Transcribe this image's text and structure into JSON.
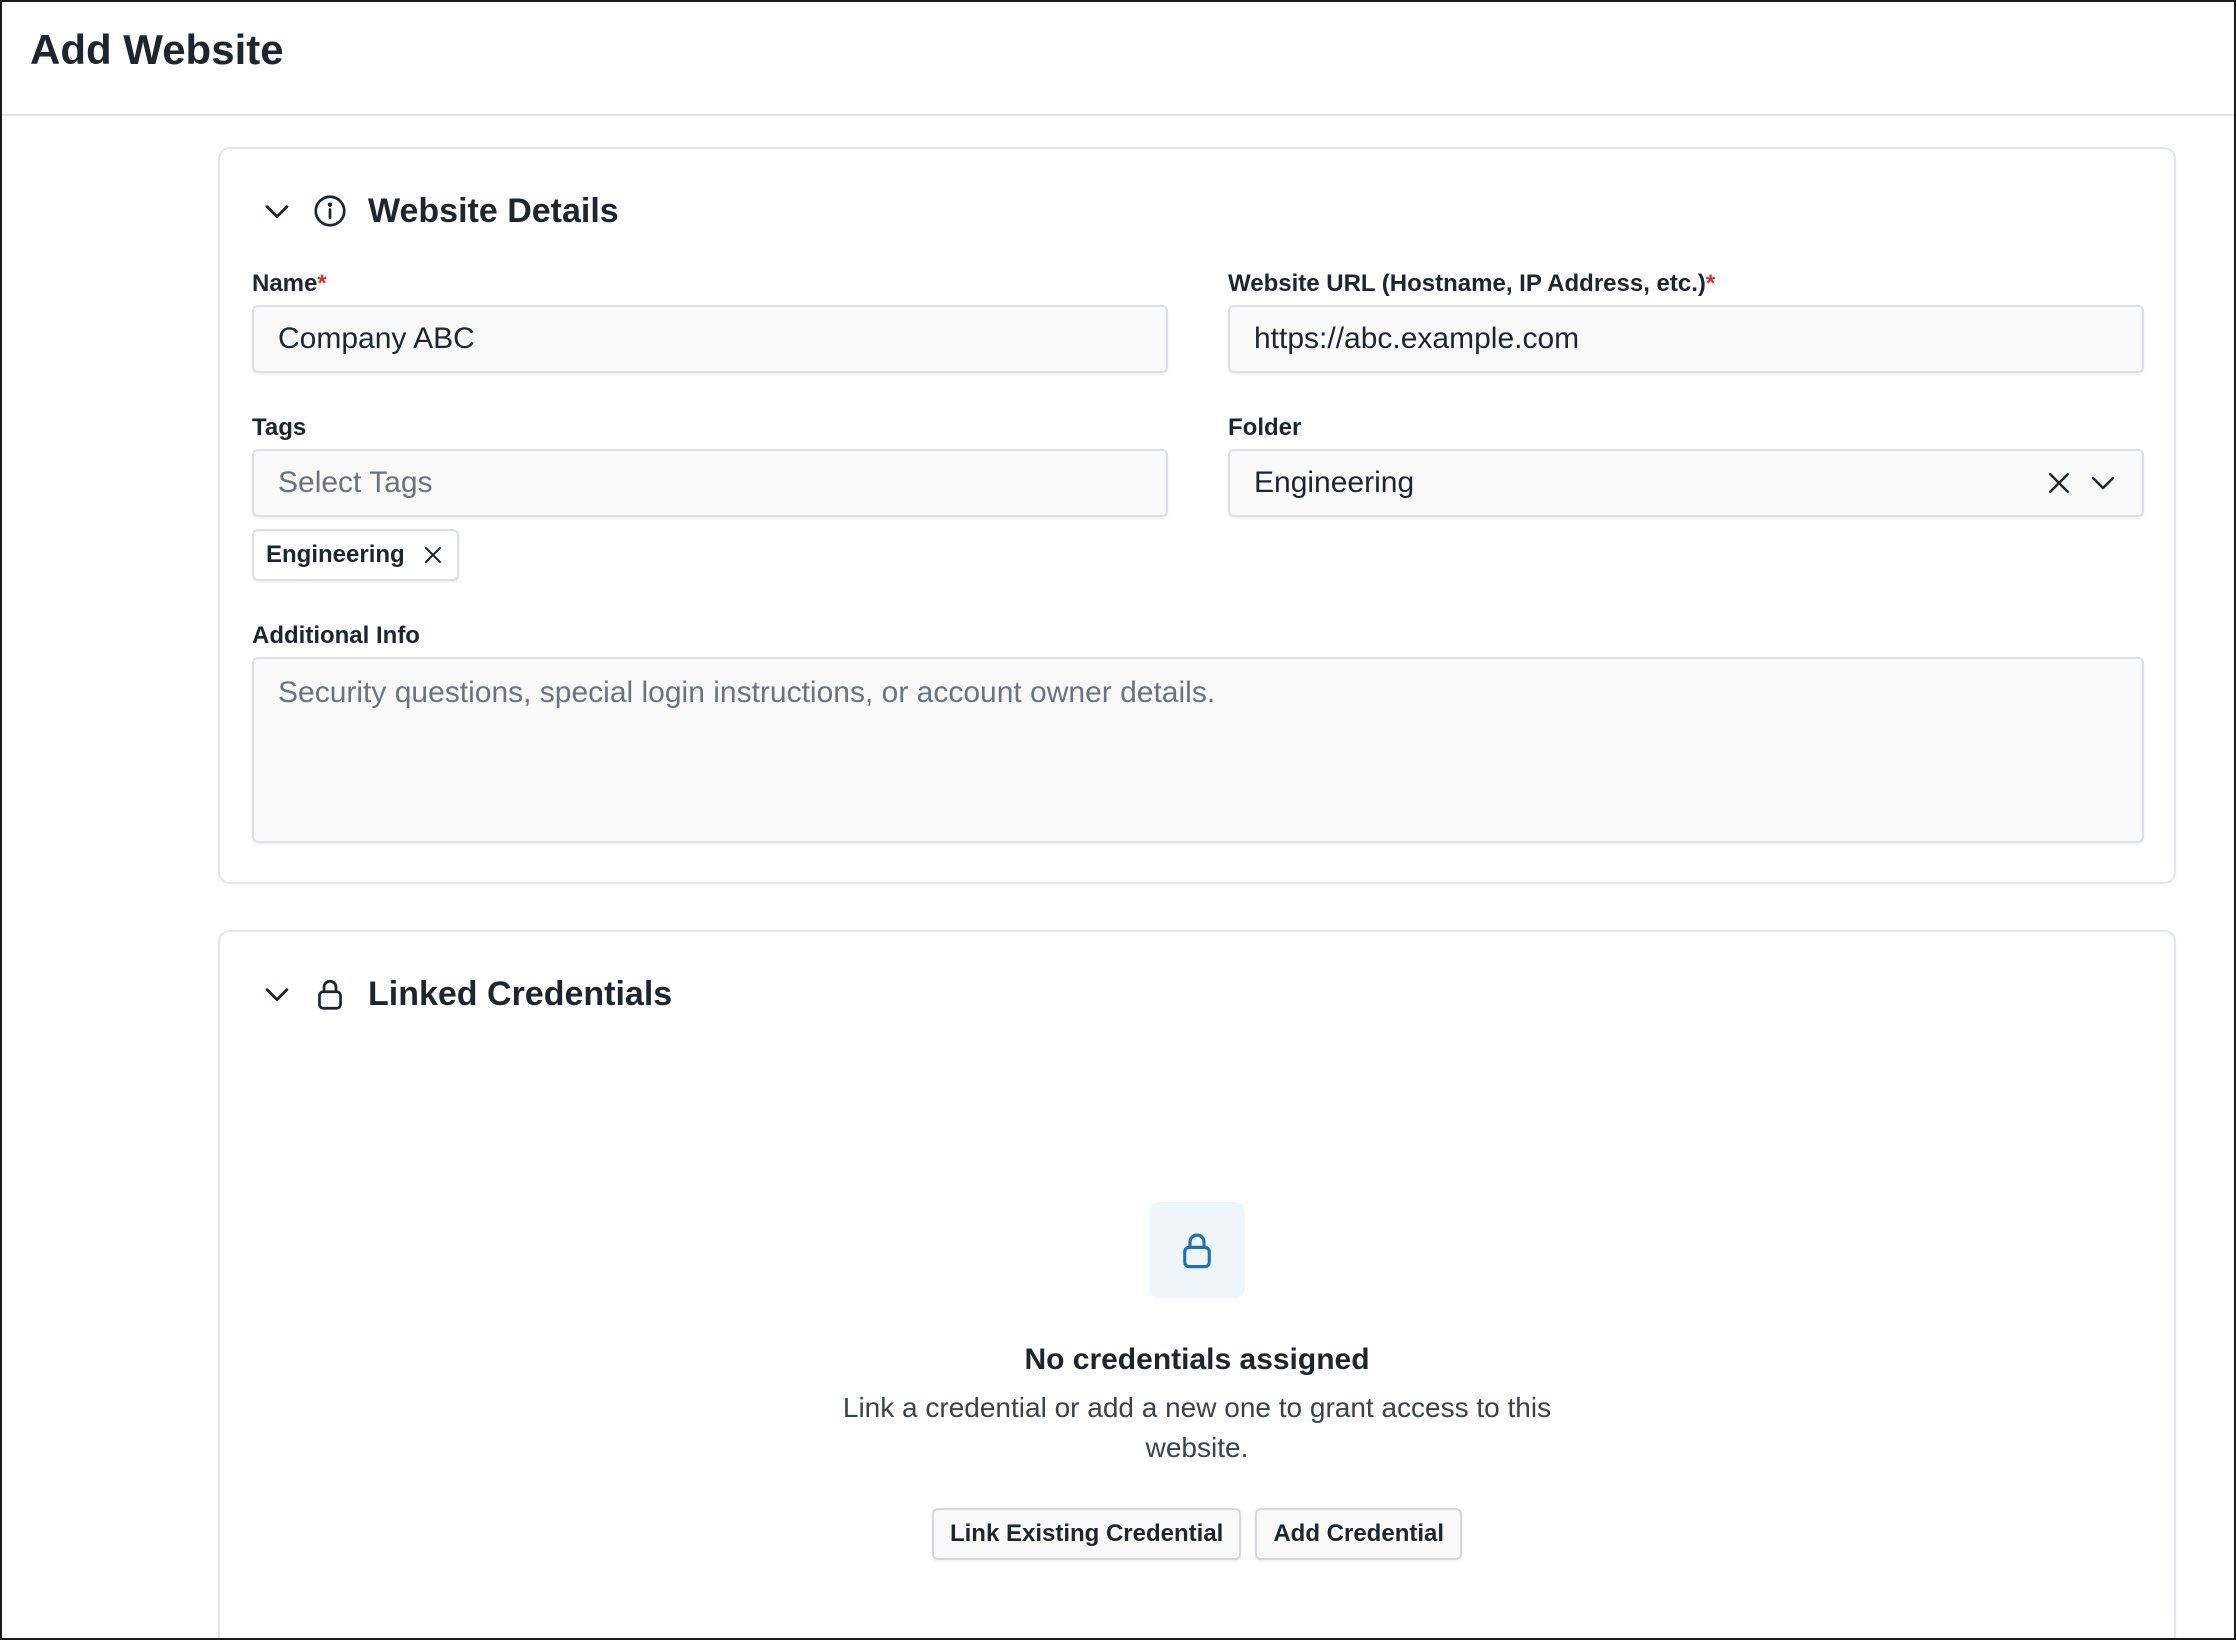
{
  "page": {
    "title": "Add Website"
  },
  "website_details": {
    "section_title": "Website Details",
    "name": {
      "label": "Name",
      "required_mark": "*",
      "value": "Company ABC"
    },
    "url": {
      "label": "Website URL (Hostname, IP Address, etc.)",
      "required_mark": "*",
      "value": "https://abc.example.com"
    },
    "tags": {
      "label": "Tags",
      "placeholder": "Select Tags",
      "selected": [
        "Engineering"
      ]
    },
    "folder": {
      "label": "Folder",
      "value": "Engineering"
    },
    "additional_info": {
      "label": "Additional Info",
      "placeholder": "Security questions, special login instructions, or account owner details."
    }
  },
  "linked_credentials": {
    "section_title": "Linked Credentials",
    "empty_title": "No credentials assigned",
    "empty_description": "Link a credential or add a new one to grant access to this website.",
    "link_button": "Link Existing Credential",
    "add_button": "Add Credential"
  },
  "icons": {
    "collapse": "chevron-down-icon",
    "info": "info-icon",
    "lock": "lock-icon",
    "clear": "close-icon"
  },
  "colors": {
    "required": "#d0312d",
    "lock_accent": "#1f6fb2",
    "lock_bg": "#eef5fb"
  }
}
